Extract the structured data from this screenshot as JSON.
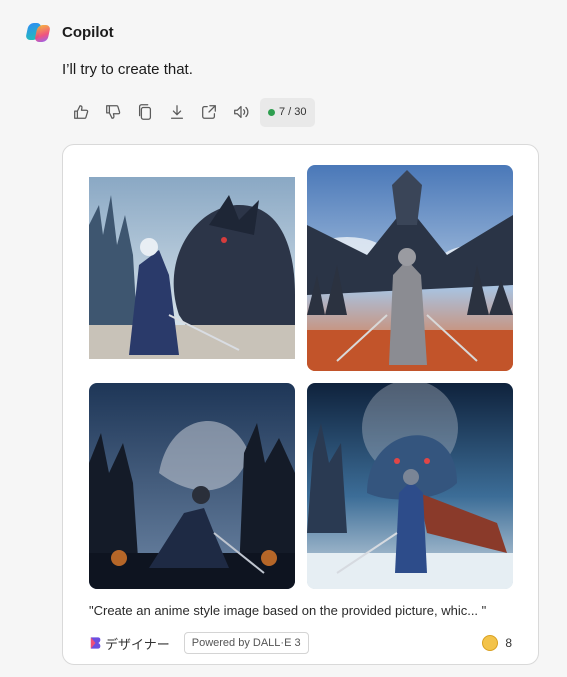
{
  "assistant": {
    "name": "Copilot"
  },
  "message": {
    "text": "I’ll try to create that."
  },
  "actions": {
    "icons": [
      "thumbs-up-icon",
      "thumbs-down-icon",
      "copy-icon",
      "download-icon",
      "share-icon",
      "speaker-icon"
    ],
    "counter": "7 / 30",
    "counter_status_color": "#2e9e4f"
  },
  "images": [
    {
      "subject": "white-haired swordsman facing a black dragon near castle spires"
    },
    {
      "subject": "armored knight before a dragon, city in flames"
    },
    {
      "subject": "caped knight beneath a dragon in a gothic city"
    },
    {
      "subject": "blue-armored knight with red cape facing a blue dragon"
    }
  ],
  "prompt_caption": "\"Create an anime style image based on the provided picture, whic... \"",
  "footer": {
    "designer_label": "デザイナー",
    "powered_by": "Powered by DALL·E 3",
    "boost_count": "8"
  }
}
